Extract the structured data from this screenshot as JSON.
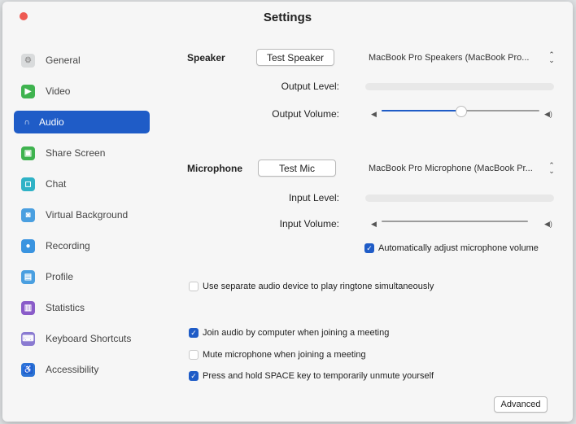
{
  "window": {
    "title": "Settings"
  },
  "sidebar": {
    "items": [
      {
        "label": "General",
        "icon": "gear-icon",
        "color": "#d9dbdc",
        "glyph": "⚙",
        "active": false
      },
      {
        "label": "Video",
        "icon": "video-camera-icon",
        "color": "#3fb34f",
        "glyph": "▶",
        "active": false
      },
      {
        "label": "Audio",
        "icon": "headphones-icon",
        "color": "#1f5cc7",
        "glyph": "∩",
        "active": true
      },
      {
        "label": "Share Screen",
        "icon": "share-screen-icon",
        "color": "#3fb34f",
        "glyph": "▣",
        "active": false
      },
      {
        "label": "Chat",
        "icon": "chat-bubble-icon",
        "color": "#2fb2c6",
        "glyph": "◻",
        "active": false
      },
      {
        "label": "Virtual Background",
        "icon": "person-background-icon",
        "color": "#4a9fe0",
        "glyph": "◙",
        "active": false
      },
      {
        "label": "Recording",
        "icon": "record-icon",
        "color": "#3a94e0",
        "glyph": "●",
        "active": false
      },
      {
        "label": "Profile",
        "icon": "profile-icon",
        "color": "#4a9fe0",
        "glyph": "▤",
        "active": false
      },
      {
        "label": "Statistics",
        "icon": "statistics-icon",
        "color": "#8a5cc9",
        "glyph": "▥",
        "active": false
      },
      {
        "label": "Keyboard Shortcuts",
        "icon": "keyboard-icon",
        "color": "#8a7ad1",
        "glyph": "⌨",
        "active": false
      },
      {
        "label": "Accessibility",
        "icon": "accessibility-icon",
        "color": "#2b73d6",
        "glyph": "♿",
        "active": false
      }
    ]
  },
  "speaker": {
    "label": "Speaker",
    "test_button": "Test Speaker",
    "device": "MacBook Pro Speakers (MacBook Pro...",
    "output_level_label": "Output Level:",
    "output_volume_label": "Output Volume:",
    "volume_fraction": 0.5
  },
  "microphone": {
    "label": "Microphone",
    "test_button": "Test Mic",
    "device": "MacBook Pro Microphone (MacBook Pr...",
    "input_level_label": "Input Level:",
    "input_volume_label": "Input Volume:",
    "volume_fraction": 0,
    "auto_adjust": {
      "label": "Automatically adjust microphone volume",
      "checked": true
    }
  },
  "options": {
    "separate_ringtone": {
      "label": "Use separate audio device to play ringtone simultaneously",
      "checked": false
    },
    "join_audio": {
      "label": "Join audio by computer when joining a meeting",
      "checked": true
    },
    "mute_mic": {
      "label": "Mute microphone when joining a meeting",
      "checked": false
    },
    "press_space": {
      "label": "Press and hold SPACE key to temporarily unmute yourself",
      "checked": true
    }
  },
  "advanced_button": "Advanced",
  "colors": {
    "accent": "#1f5cc7",
    "close": "#ee5a52"
  }
}
